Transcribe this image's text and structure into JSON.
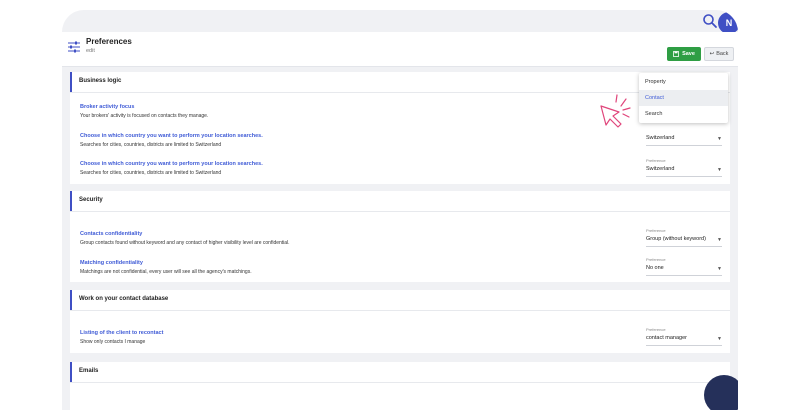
{
  "topbar": {
    "avatar_initials": "N",
    "icons": [
      "search-icon",
      "avatar"
    ]
  },
  "header": {
    "title": "Preferences",
    "subtitle": "edit",
    "save_label": "Save",
    "back_label": "Back",
    "icon": "sliders-icon",
    "save_color": "#2f9e44"
  },
  "accent_color": "#3f4fc4",
  "sections": {
    "business": {
      "title": "Business logic",
      "rows": [
        {
          "title": "Broker activity focus",
          "desc": "Your brokers' activity is focused on contacts they manage.",
          "pref_label": "Preference",
          "pref_value": "Contact"
        },
        {
          "title": "Choose in which country you want to perform your location searches.",
          "desc": "Searches for cities, countries, districts are limited to Switzerland",
          "pref_label": "Preference",
          "pref_value": "Switzerland"
        },
        {
          "title": "Choose in which country you want to perform your location searches.",
          "desc": "Searches for cities, countries, districts are limited to Switzerland",
          "pref_label": "Preference",
          "pref_value": "Switzerland"
        }
      ]
    },
    "security": {
      "title": "Security",
      "rows": [
        {
          "title": "Contacts confidentiality",
          "desc": "Group contacts found without keyword and any contact of higher visibility level are confidential.",
          "pref_label": "Preference",
          "pref_value": "Group (without keyword)"
        },
        {
          "title": "Matching confidentiality",
          "desc": "Matchings are not confidential, every user will see all the agency's matchings.",
          "pref_label": "Preference",
          "pref_value": "No one"
        }
      ]
    },
    "contacts": {
      "title": "Work on your contact database",
      "rows": [
        {
          "title": "Listing of the client to recontact",
          "desc": "Show only contacts I manage",
          "pref_label": "Preference",
          "pref_value": "contact manager"
        }
      ]
    },
    "emails": {
      "title": "Emails"
    }
  },
  "dropdown": {
    "options": [
      "Property",
      "Contact",
      "Search"
    ],
    "selected": "Contact"
  }
}
